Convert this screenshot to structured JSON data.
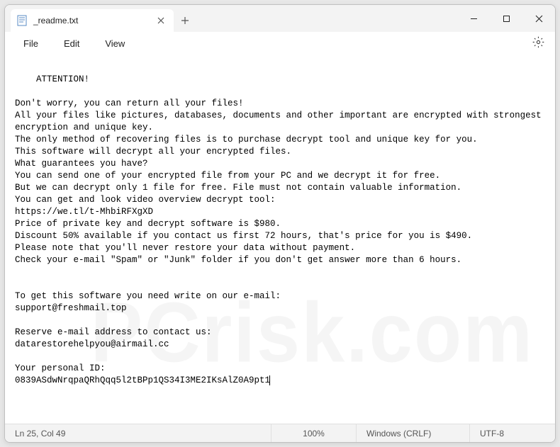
{
  "tab": {
    "title": "_readme.txt"
  },
  "menu": {
    "file": "File",
    "edit": "Edit",
    "view": "View"
  },
  "content": {
    "body": "ATTENTION!\n\nDon't worry, you can return all your files!\nAll your files like pictures, databases, documents and other important are encrypted with strongest encryption and unique key.\nThe only method of recovering files is to purchase decrypt tool and unique key for you.\nThis software will decrypt all your encrypted files.\nWhat guarantees you have?\nYou can send one of your encrypted file from your PC and we decrypt it for free.\nBut we can decrypt only 1 file for free. File must not contain valuable information.\nYou can get and look video overview decrypt tool:\nhttps://we.tl/t-MhbiRFXgXD\nPrice of private key and decrypt software is $980.\nDiscount 50% available if you contact us first 72 hours, that's price for you is $490.\nPlease note that you'll never restore your data without payment.\nCheck your e-mail \"Spam\" or \"Junk\" folder if you don't get answer more than 6 hours.\n\n\nTo get this software you need write on our e-mail:\nsupport@freshmail.top\n\nReserve e-mail address to contact us:\ndatarestorehelpyou@airmail.cc\n\nYour personal ID:\n0839ASdwNrqpaQRhQqq5l2tBPp1QS34I3ME2IKsAlZ0A9pt1"
  },
  "status": {
    "position": "Ln 25, Col 49",
    "zoom": "100%",
    "eol": "Windows (CRLF)",
    "encoding": "UTF-8"
  },
  "watermark": "PCrisk.com"
}
